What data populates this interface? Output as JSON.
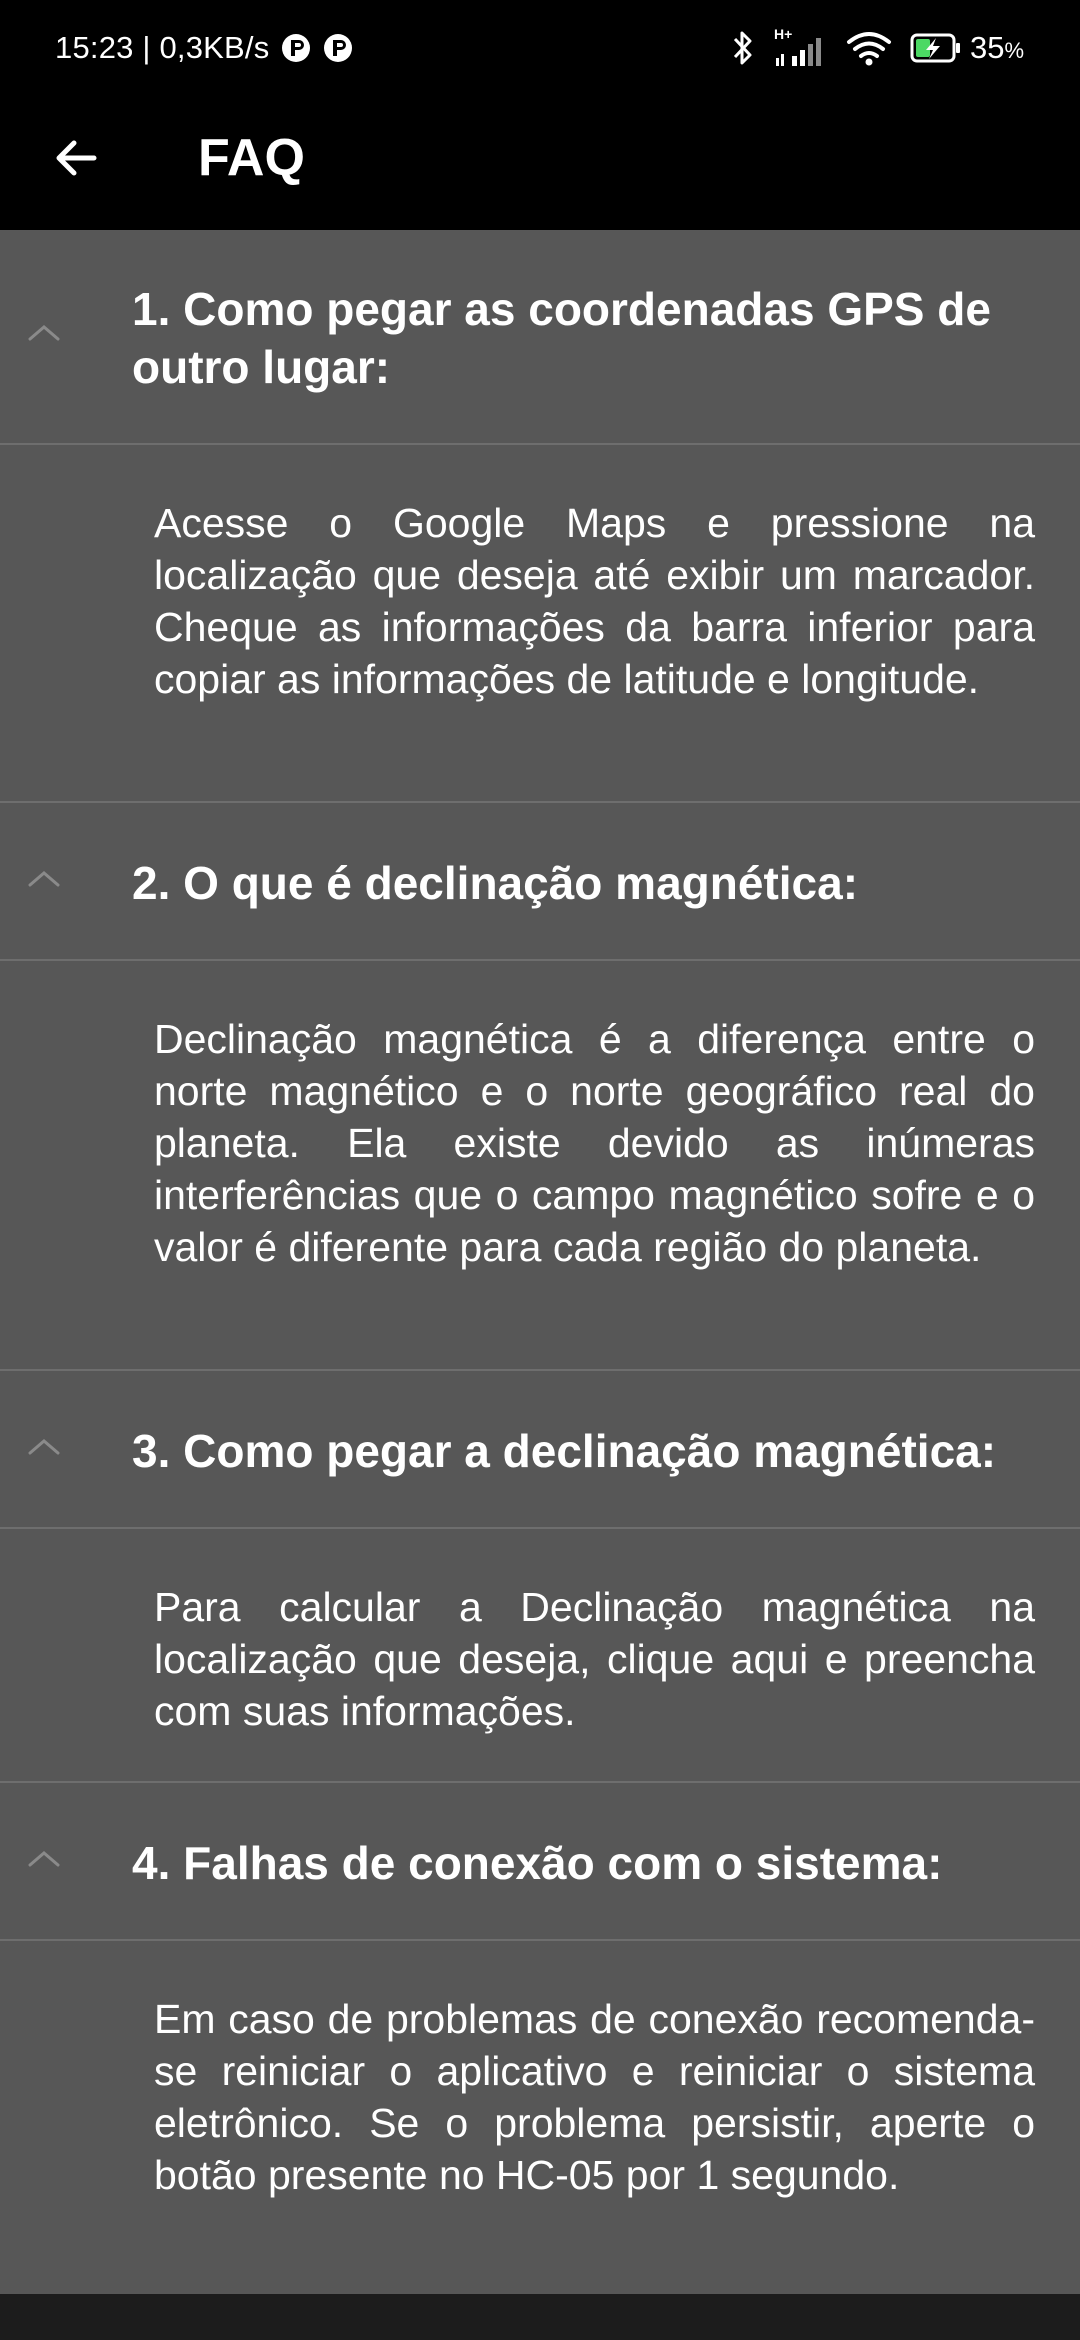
{
  "status_bar": {
    "time_speed": "15:23 | 0,3KB/s",
    "network_type": "H+",
    "battery_percent": "35",
    "battery_unit": "%",
    "icons": [
      "notification-app-icon",
      "notification-app-icon",
      "bluetooth-icon",
      "signal-icon",
      "wifi-icon",
      "battery-charging-icon"
    ]
  },
  "toolbar": {
    "title": "FAQ",
    "back_icon": "arrow-left-icon"
  },
  "faq": {
    "items": [
      {
        "question": "1. Como pegar as coordenadas GPS de outro lugar:",
        "answer": "Acesse o Google Maps e pressione na localização que deseja até exibir um marcador. Cheque as informações da barra inferior para copiar as informações de latitude e longitude."
      },
      {
        "question": "2. O que é declinação magnética:",
        "answer": "Declinação magnética é a diferença entre o norte magnético e o norte geográfico real do planeta. Ela existe devido as inúmeras interferências que o campo magnético sofre e o valor é diferente para cada região do planeta."
      },
      {
        "question": "3. Como pegar a declinação magnética:",
        "answer": "Para calcular a Declinação magnética na localização que deseja, clique aqui e preencha com suas informações."
      },
      {
        "question": "4. Falhas de conexão com o sistema:",
        "answer": "Em caso de problemas de conexão recomenda-se reiniciar o aplicativo e reiniciar o sistema eletrônico. Se o problema persistir, aperte o botão presente no HC-05 por 1 segundo."
      }
    ]
  },
  "colors": {
    "background": "#575757",
    "toolbar": "#000000",
    "divider": "#6e6e6e",
    "text": "#ffffff",
    "chevron": "#8a8a8a"
  }
}
